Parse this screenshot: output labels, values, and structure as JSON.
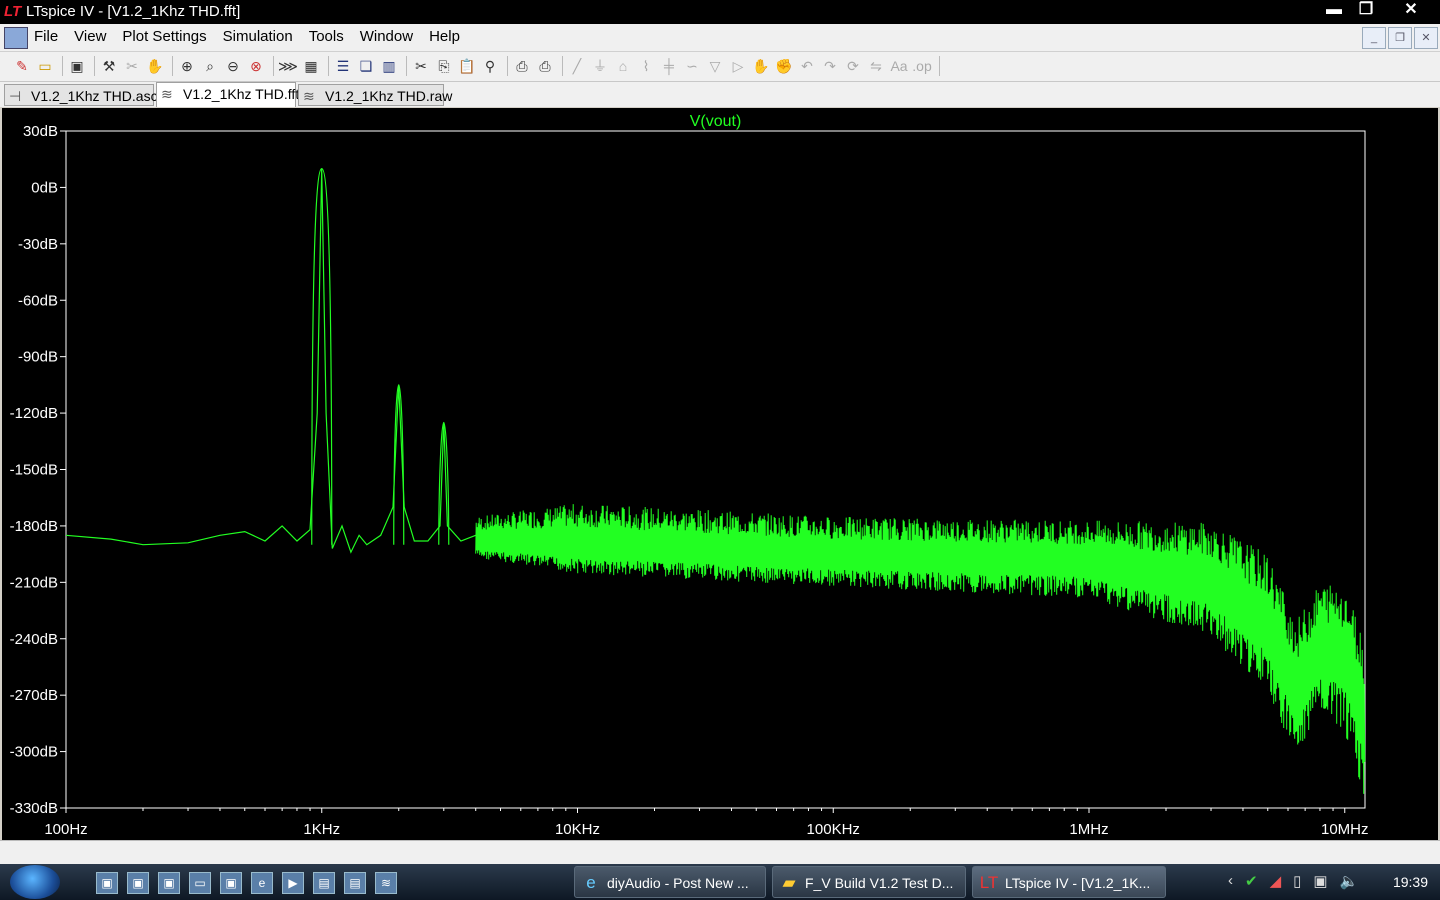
{
  "window": {
    "title": "LTspice IV - [V1.2_1Khz THD.fft]",
    "buttons": {
      "minimize": "▬",
      "restore": "❐",
      "close": "✕"
    }
  },
  "menu": [
    "File",
    "View",
    "Plot Settings",
    "Simulation",
    "Tools",
    "Window",
    "Help"
  ],
  "toolbar_icons": [
    "new-schematic",
    "open",
    "save",
    "control-panel",
    "cut-wire",
    "pan",
    "zoom-in",
    "zoom-area",
    "zoom-out",
    "zoom-fit",
    "autorange",
    "grid",
    "tile-horizontal",
    "cascade",
    "tile-vertical",
    "cut",
    "copy",
    "paste",
    "find",
    "print-setup",
    "print",
    "wire",
    "ground",
    "label",
    "resistor",
    "capacitor",
    "inductor",
    "diode",
    "component",
    "move",
    "drag",
    "undo",
    "redo",
    "rotate",
    "mirror",
    "text",
    "spice-directive"
  ],
  "tabs": [
    {
      "label": "V1.2_1Khz THD.asc",
      "icon": "schematic-icon",
      "active": false
    },
    {
      "label": "V1.2_1Khz THD.fft",
      "icon": "waveform-icon",
      "active": true
    },
    {
      "label": "V1.2_1Khz THD.raw",
      "icon": "waveform-icon",
      "active": false
    }
  ],
  "chart_data": {
    "type": "line",
    "title": "V(vout)",
    "xscale": "log",
    "xlim": [
      100,
      12000000
    ],
    "ylim": [
      -330,
      30
    ],
    "ylabel": "",
    "xlabel": "",
    "y_ticks": [
      "30dB",
      "0dB",
      "-30dB",
      "-60dB",
      "-90dB",
      "-120dB",
      "-150dB",
      "-180dB",
      "-210dB",
      "-240dB",
      "-270dB",
      "-300dB",
      "-330dB"
    ],
    "x_ticks": [
      {
        "label": "100Hz",
        "value": 100
      },
      {
        "label": "1KHz",
        "value": 1000
      },
      {
        "label": "10KHz",
        "value": 10000
      },
      {
        "label": "100KHz",
        "value": 100000
      },
      {
        "label": "1MHz",
        "value": 1000000
      },
      {
        "label": "10MHz",
        "value": 10000000
      }
    ],
    "color": "#22ff22",
    "series": [
      {
        "values_x": [
          100,
          150,
          200,
          300,
          400,
          500,
          600,
          700,
          800,
          900,
          960,
          1000,
          1040,
          1100,
          1200,
          1300,
          1400,
          1500,
          1700,
          1900,
          2000,
          2100,
          2300,
          2600,
          2900,
          3000,
          3100,
          3500,
          4000,
          5000,
          6000,
          8000,
          10000,
          15000,
          20000,
          30000,
          50000,
          100000,
          200000,
          500000,
          1000000,
          2000000,
          3000000,
          4000000,
          5000000,
          6000000,
          6500000,
          7000000,
          8000000,
          9000000,
          10000000,
          11000000,
          12000000
        ],
        "values_y": [
          -185,
          -187,
          -190,
          -189,
          -185,
          -183,
          -188,
          -180,
          -188,
          -182,
          -120,
          10,
          -120,
          -192,
          -180,
          -194,
          -185,
          -190,
          -185,
          -170,
          -105,
          -170,
          -188,
          -188,
          -180,
          -125,
          -180,
          -188,
          -185,
          -190,
          -190,
          -195,
          -193,
          -192,
          -190,
          -188,
          -185,
          -183,
          -182,
          -181,
          -180,
          -182,
          -185,
          -195,
          -200,
          -215,
          -220,
          -215,
          -205,
          -210,
          -230,
          -260,
          -300
        ],
        "noise_band": [
          {
            "x": 4000,
            "top": -175,
            "bottom": -200
          },
          {
            "x": 10000,
            "top": -168,
            "bottom": -210
          },
          {
            "x": 100000,
            "top": -175,
            "bottom": -215
          },
          {
            "x": 1000000,
            "top": -177,
            "bottom": -220
          },
          {
            "x": 3000000,
            "top": -178,
            "bottom": -240
          },
          {
            "x": 5000000,
            "top": -195,
            "bottom": -270
          },
          {
            "x": 6500000,
            "top": -230,
            "bottom": -305
          },
          {
            "x": 8000000,
            "top": -210,
            "bottom": -280
          },
          {
            "x": 10000000,
            "top": -210,
            "bottom": -290
          },
          {
            "x": 12000000,
            "top": -240,
            "bottom": -325
          }
        ]
      }
    ]
  },
  "taskbar": {
    "tasks": [
      {
        "label": "diyAudio - Post New ...",
        "icon": "ie-icon"
      },
      {
        "label": "F_V Build V1.2 Test D...",
        "icon": "folder-icon"
      },
      {
        "label": "LTspice IV - [V1.2_1K...",
        "icon": "ltspice-icon"
      }
    ],
    "clock": "19:39"
  }
}
